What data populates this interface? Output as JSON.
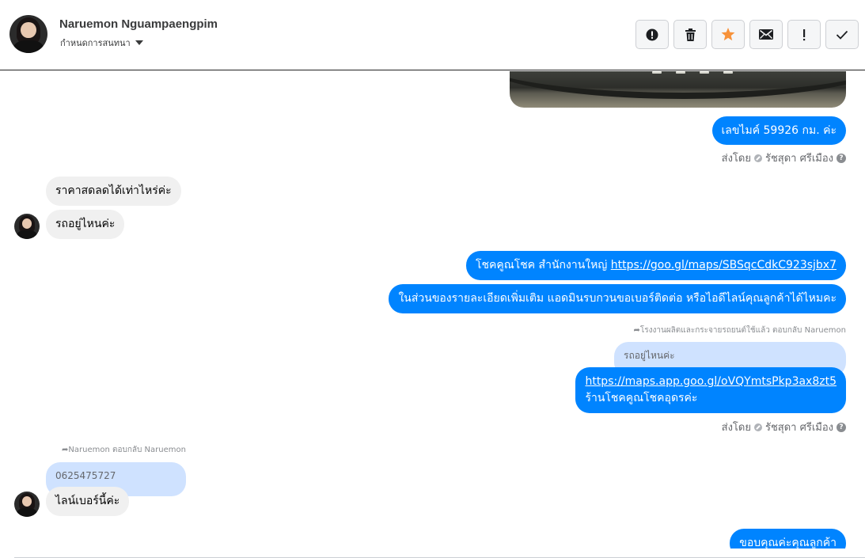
{
  "header": {
    "name": "Naruemon Nguampaengpim",
    "subtitle": "กำหนดการสนทนา",
    "toolbar": [
      {
        "icon": "alert-circle-icon",
        "glyph": "!"
      },
      {
        "icon": "trash-icon",
        "glyph": ""
      },
      {
        "icon": "star-icon",
        "glyph": "★",
        "color": "#f7923a"
      },
      {
        "icon": "envelope-icon",
        "glyph": "✉"
      },
      {
        "icon": "exclamation-icon",
        "glyph": "!"
      },
      {
        "icon": "checkmark-icon",
        "glyph": "✓"
      }
    ]
  },
  "messages": {
    "m1": "เลขไมค์ 59926  กม.  ค่ะ",
    "sent_by_1": {
      "prefix": "ส่งโดย",
      "agent": "รัชสุดา ศรีเมือง"
    },
    "m2": "ราคาสดลดได้เท่าไหร่ค่ะ",
    "m3": "รถอยู่ไหนค่ะ",
    "m4_text": "โชคคูณโชค สำนักงานใหญ่ ",
    "m4_link": "https://goo.gl/maps/SBSqcCdkC923sjbx7",
    "m5": "ในส่วนของรายละเอียดเพิ่มเติม แอดมินรบกวนขอเบอร์ติดต่อ หรือไอดีไลน์คุณลูกค้าได้ไหมคะ",
    "reply_meta_1": "โรงงานผลิตและกระจายรถยนต์ใช้แล้ว ตอบกลับ Naruemon",
    "quote_1": "รถอยู่ไหนค่ะ",
    "m6_link": "https://maps.app.goo.gl/oVQYmtsPkp3ax8zt5",
    "m6_text": "ร้านโชคคูณโชคอุดรค่ะ",
    "sent_by_2": {
      "prefix": "ส่งโดย",
      "agent": "รัชสุดา ศรีเมือง"
    },
    "reply_meta_2": "Naruemon ตอบกลับ Naruemon",
    "quote_2": "0625475727",
    "m7": "ไลน์เบอร์นี้ค่ะ",
    "m8": "ขอบคุณค่ะคุณลูกค้า"
  },
  "colors": {
    "outgoing": "#0084ff",
    "incoming": "#f0f0f0",
    "quote": "#cfe2ff",
    "star": "#f7923a"
  }
}
